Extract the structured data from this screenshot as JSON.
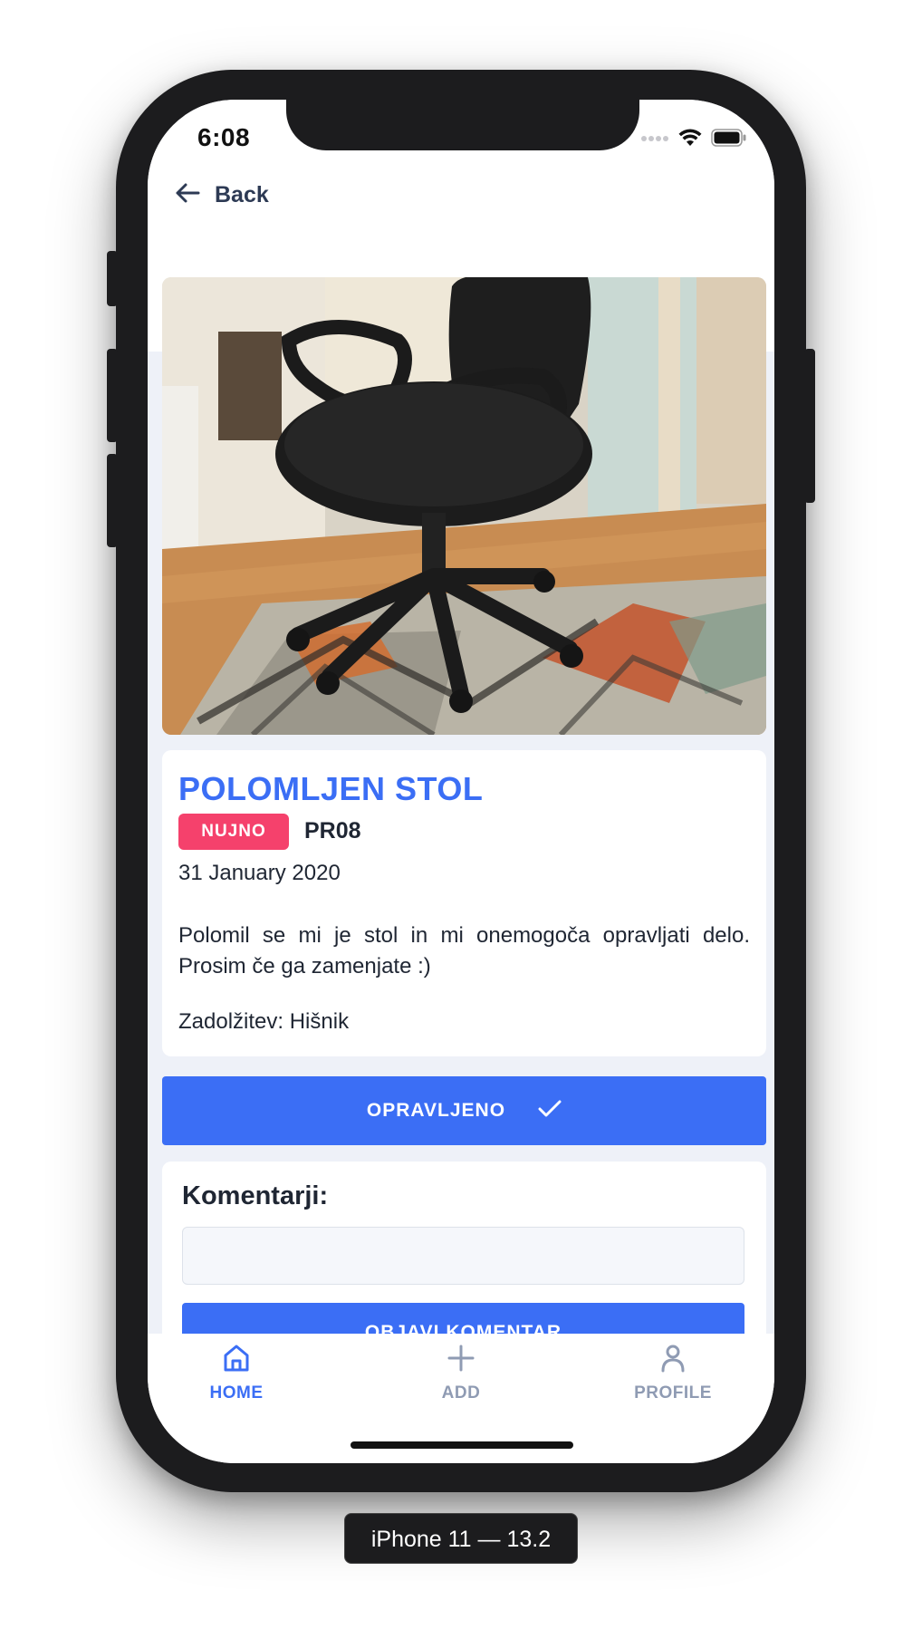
{
  "status_bar": {
    "time": "6:08",
    "icons": [
      "signal-icon",
      "wifi-icon",
      "battery-icon"
    ]
  },
  "nav": {
    "back_label": "Back",
    "back_icon": "arrow-left-icon"
  },
  "issue": {
    "photo_alt": "Broken office chair",
    "title": "POLOMLJEN STOL",
    "priority": "NUJNO",
    "room": "PR08",
    "date": "31 January 2020",
    "description": "Polomil se mi je stol in mi onemogoča opravljati delo. Prosim če ga zamenjate :)",
    "assignment": "Zadolžitev: Hišnik"
  },
  "actions": {
    "done_label": "OPRAVLJENO",
    "done_icon": "checkmark-icon"
  },
  "comments": {
    "heading": "Komentarji:",
    "input_value": "",
    "post_label": "OBJAVI KOMENTAR"
  },
  "tab_bar": {
    "tabs": [
      {
        "label": "HOME",
        "icon": "home-icon",
        "active": true
      },
      {
        "label": "ADD",
        "icon": "plus-icon",
        "active": false
      },
      {
        "label": "PROFILE",
        "icon": "user-icon",
        "active": false
      }
    ]
  },
  "device_label": "iPhone 11 — 13.2",
  "colors": {
    "accent": "#3b6ef5",
    "priority": "#f5416c",
    "text": "#1f2633",
    "inactive_tab": "#8f9bb3",
    "background": "#eef1f8"
  }
}
